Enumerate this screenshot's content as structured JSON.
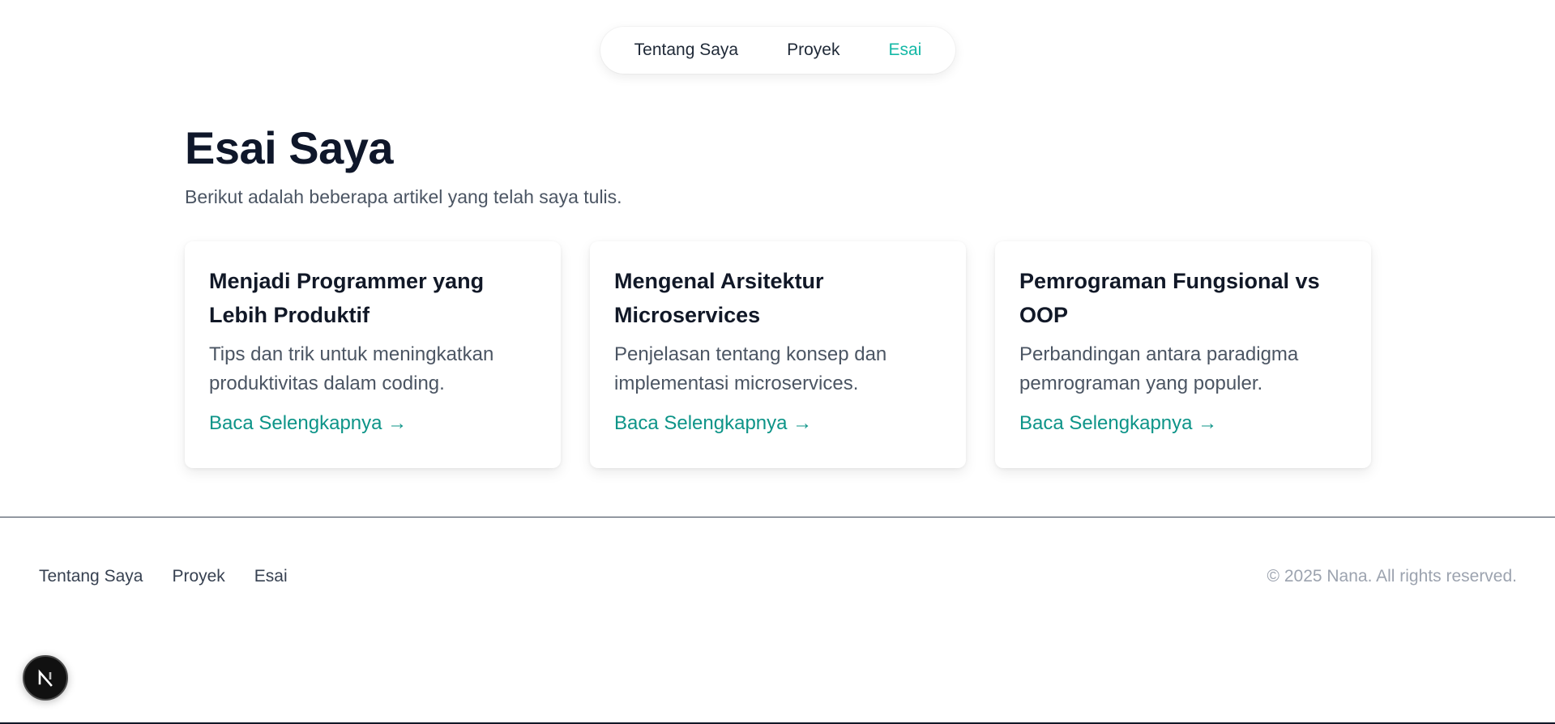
{
  "nav": {
    "items": [
      {
        "label": "Tentang Saya",
        "active": false
      },
      {
        "label": "Proyek",
        "active": false
      },
      {
        "label": "Esai",
        "active": true
      }
    ],
    "active_color": "#14b8a6"
  },
  "header": {
    "title": "Esai Saya",
    "subtitle": "Berikut adalah beberapa artikel yang telah saya tulis."
  },
  "articles": [
    {
      "title": "Menjadi Programmer yang Lebih Produktif",
      "description": "Tips dan trik untuk meningkatkan produktivitas dalam coding.",
      "link_label": "Baca Selengkapnya →"
    },
    {
      "title": "Mengenal Arsitektur Microservices",
      "description": "Penjelasan tentang konsep dan implementasi microservices.",
      "link_label": "Baca Selengkapnya →"
    },
    {
      "title": "Pemrograman Fungsional vs OOP",
      "description": "Perbandingan antara paradigma pemrograman yang populer.",
      "link_label": "Baca Selengkapnya →"
    }
  ],
  "footer": {
    "links": [
      "Tentang Saya",
      "Proyek",
      "Esai"
    ],
    "copyright": "© 2025 Nana. All rights reserved."
  },
  "dev_badge": {
    "icon": "nextjs-logo-icon"
  },
  "colors": {
    "accent": "#0d9488",
    "title": "#0f172a",
    "body_text": "#4b5563"
  }
}
